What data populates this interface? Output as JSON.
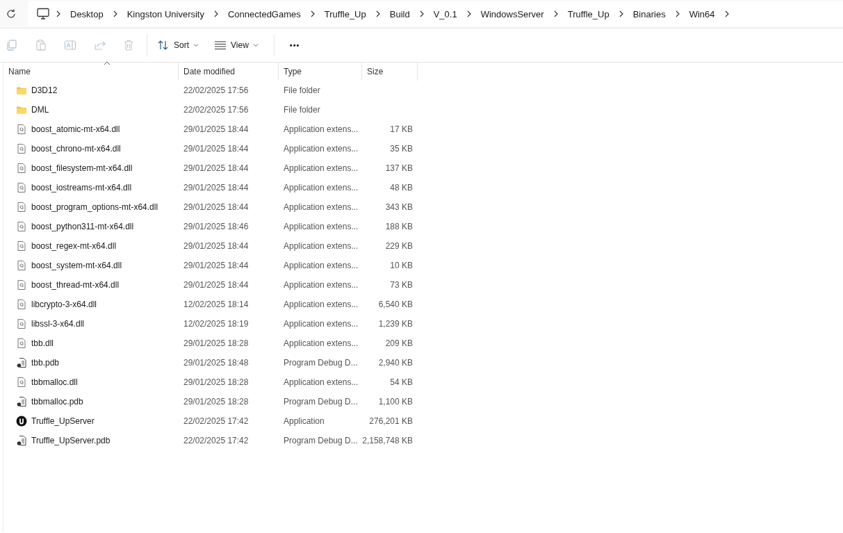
{
  "breadcrumb": [
    "Desktop",
    "Kingston University",
    "ConnectedGames",
    "Truffle_Up",
    "Build",
    "V_0.1",
    "WindowsServer",
    "Truffle_Up",
    "Binaries",
    "Win64"
  ],
  "toolbar": {
    "sort": "Sort",
    "view": "View",
    "more": "•••"
  },
  "columns": [
    "Name",
    "Date modified",
    "Type",
    "Size"
  ],
  "files": [
    {
      "kind": "folder",
      "name": "D3D12",
      "date": "22/02/2025 17:56",
      "type": "File folder"
    },
    {
      "kind": "folder",
      "name": "DML",
      "date": "22/02/2025 17:56",
      "type": "File folder"
    },
    {
      "kind": "dll",
      "name": "boost_atomic-mt-x64.dll",
      "date": "29/01/2025 18:44",
      "type": "Application extens...",
      "size": "17 KB"
    },
    {
      "kind": "dll",
      "name": "boost_chrono-mt-x64.dll",
      "date": "29/01/2025 18:44",
      "type": "Application extens...",
      "size": "35 KB"
    },
    {
      "kind": "dll",
      "name": "boost_filesystem-mt-x64.dll",
      "date": "29/01/2025 18:44",
      "type": "Application extens...",
      "size": "137 KB"
    },
    {
      "kind": "dll",
      "name": "boost_iostreams-mt-x64.dll",
      "date": "29/01/2025 18:44",
      "type": "Application extens...",
      "size": "48 KB"
    },
    {
      "kind": "dll",
      "name": "boost_program_options-mt-x64.dll",
      "date": "29/01/2025 18:44",
      "type": "Application extens...",
      "size": "343 KB"
    },
    {
      "kind": "dll",
      "name": "boost_python311-mt-x64.dll",
      "date": "29/01/2025 18:46",
      "type": "Application extens...",
      "size": "188 KB"
    },
    {
      "kind": "dll",
      "name": "boost_regex-mt-x64.dll",
      "date": "29/01/2025 18:44",
      "type": "Application extens...",
      "size": "229 KB"
    },
    {
      "kind": "dll",
      "name": "boost_system-mt-x64.dll",
      "date": "29/01/2025 18:44",
      "type": "Application extens...",
      "size": "10 KB"
    },
    {
      "kind": "dll",
      "name": "boost_thread-mt-x64.dll",
      "date": "29/01/2025 18:44",
      "type": "Application extens...",
      "size": "73 KB"
    },
    {
      "kind": "dll",
      "name": "libcrypto-3-x64.dll",
      "date": "12/02/2025 18:14",
      "type": "Application extens...",
      "size": "6,540 KB"
    },
    {
      "kind": "dll",
      "name": "libssl-3-x64.dll",
      "date": "12/02/2025 18:19",
      "type": "Application extens...",
      "size": "1,239 KB"
    },
    {
      "kind": "dll",
      "name": "tbb.dll",
      "date": "29/01/2025 18:28",
      "type": "Application extens...",
      "size": "209 KB"
    },
    {
      "kind": "pdb",
      "name": "tbb.pdb",
      "date": "29/01/2025 18:48",
      "type": "Program Debug D...",
      "size": "2,940 KB"
    },
    {
      "kind": "dll",
      "name": "tbbmalloc.dll",
      "date": "29/01/2025 18:28",
      "type": "Application extens...",
      "size": "54 KB"
    },
    {
      "kind": "pdb",
      "name": "tbbmalloc.pdb",
      "date": "29/01/2025 18:28",
      "type": "Program Debug D...",
      "size": "1,100 KB"
    },
    {
      "kind": "app",
      "name": "Truffle_UpServer",
      "date": "22/02/2025 17:42",
      "type": "Application",
      "size": "276,201 KB"
    },
    {
      "kind": "pdb",
      "name": "Truffle_UpServer.pdb",
      "date": "22/02/2025 17:42",
      "type": "Program Debug D...",
      "size": "2,158,748 KB"
    }
  ]
}
